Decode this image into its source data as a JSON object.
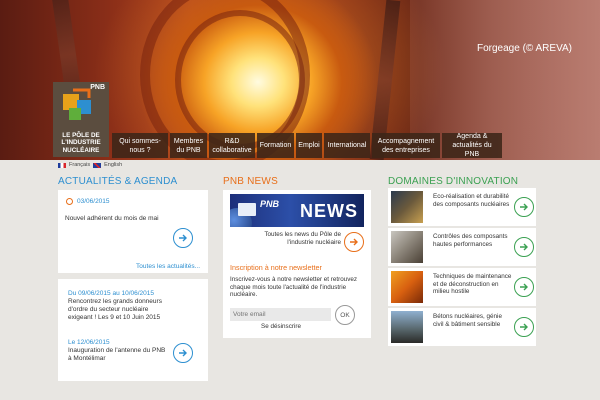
{
  "hero": {
    "caption": "Forgeage (© AREVA)"
  },
  "logo": {
    "brand": "PNB",
    "name_line1": "Le Pôle de",
    "name_line2": "l'industrie",
    "name_line3": "nucléaire"
  },
  "nav": [
    {
      "label": "Qui sommes-nous ?"
    },
    {
      "label": "Membres du PNB"
    },
    {
      "label": "R&D collaborative"
    },
    {
      "label": "Formation"
    },
    {
      "label": "Emploi"
    },
    {
      "label": "International"
    },
    {
      "label": "Accompagnement des entreprises"
    },
    {
      "label": "Agenda & actualités du PNB"
    }
  ],
  "lang": {
    "fr": "Français",
    "en": "English"
  },
  "actualites": {
    "title": "ACTUALITÉS & AGENDA",
    "news_date": "03/06/2015",
    "news_text": "Nouvel adhérent du mois de mai",
    "more_link": "Toutes les actualités...",
    "events": [
      {
        "date": "Du 09/06/2015 au 10/06/2015",
        "text": "Rencontrez les grands donneurs d'ordre du secteur nucléaire exigeant ! Les 9 et 10 Juin 2015"
      },
      {
        "date": "Le 12/06/2015",
        "text": "Inauguration de l'antenne du PNB à Montélimar"
      }
    ]
  },
  "pnbnews": {
    "title": "PNB NEWS",
    "banner_small": "PNB",
    "banner_big": "NEWS",
    "newsletter_text": "Toutes les news du Pôle de l'industrie nucléaire",
    "sub_title": "Inscription à notre newsletter",
    "sub_desc": "Inscrivez-vous à notre newsletter et retrouvez chaque mois toute l'actualité de l'industrie nucléaire.",
    "email_placeholder": "Votre email",
    "ok_label": "OK",
    "unsubscribe": "Se désinscrire"
  },
  "domaines": {
    "title": "DOMAINES D'INNOVATION",
    "items": [
      {
        "label": "Eco-réalisation et durabilité des composants nucléaires"
      },
      {
        "label": "Contrôles des composants hautes performances"
      },
      {
        "label": "Techniques de maintenance et de déconstruction en milieu hostile"
      },
      {
        "label": "Bétons nucléaires, génie civil & bâtiment sensible"
      }
    ]
  },
  "colors": {
    "blue": "#2d8fd0",
    "orange": "#e86f1a",
    "green": "#3ba152",
    "nav_bg": "#3c2618"
  }
}
